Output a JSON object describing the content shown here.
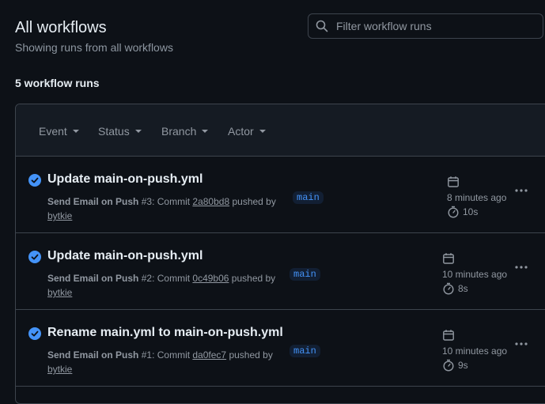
{
  "header": {
    "title": "All workflows",
    "subtitle": "Showing runs from all workflows"
  },
  "search": {
    "placeholder": "Filter workflow runs"
  },
  "runs_count": "5 workflow runs",
  "filters": [
    "Event",
    "Status",
    "Branch",
    "Actor"
  ],
  "colors": {
    "success": "#4493f8",
    "background": "#0d1117",
    "border": "#3d444d",
    "muted": "#9198a1"
  },
  "runs": [
    {
      "title": "Update main-on-push.yml",
      "workflow": "Send Email on Push",
      "run_number": "#3",
      "commit_label": ": Commit",
      "commit": "2a80bd8",
      "pushed_by": "pushed by",
      "actor": "bytkie",
      "branch": "main",
      "time_ago": "8 minutes ago",
      "duration": "10s"
    },
    {
      "title": "Update main-on-push.yml",
      "workflow": "Send Email on Push",
      "run_number": "#2",
      "commit_label": ": Commit",
      "commit": "0c49b06",
      "pushed_by": "pushed by",
      "actor": "bytkie",
      "branch": "main",
      "time_ago": "10 minutes ago",
      "duration": "8s"
    },
    {
      "title": "Rename main.yml to main-on-push.yml",
      "workflow": "Send Email on Push",
      "run_number": "#1",
      "commit_label": ": Commit",
      "commit": "da0fec7",
      "pushed_by": "pushed by",
      "actor": "bytkie",
      "branch": "main",
      "time_ago": "10 minutes ago",
      "duration": "9s"
    }
  ]
}
